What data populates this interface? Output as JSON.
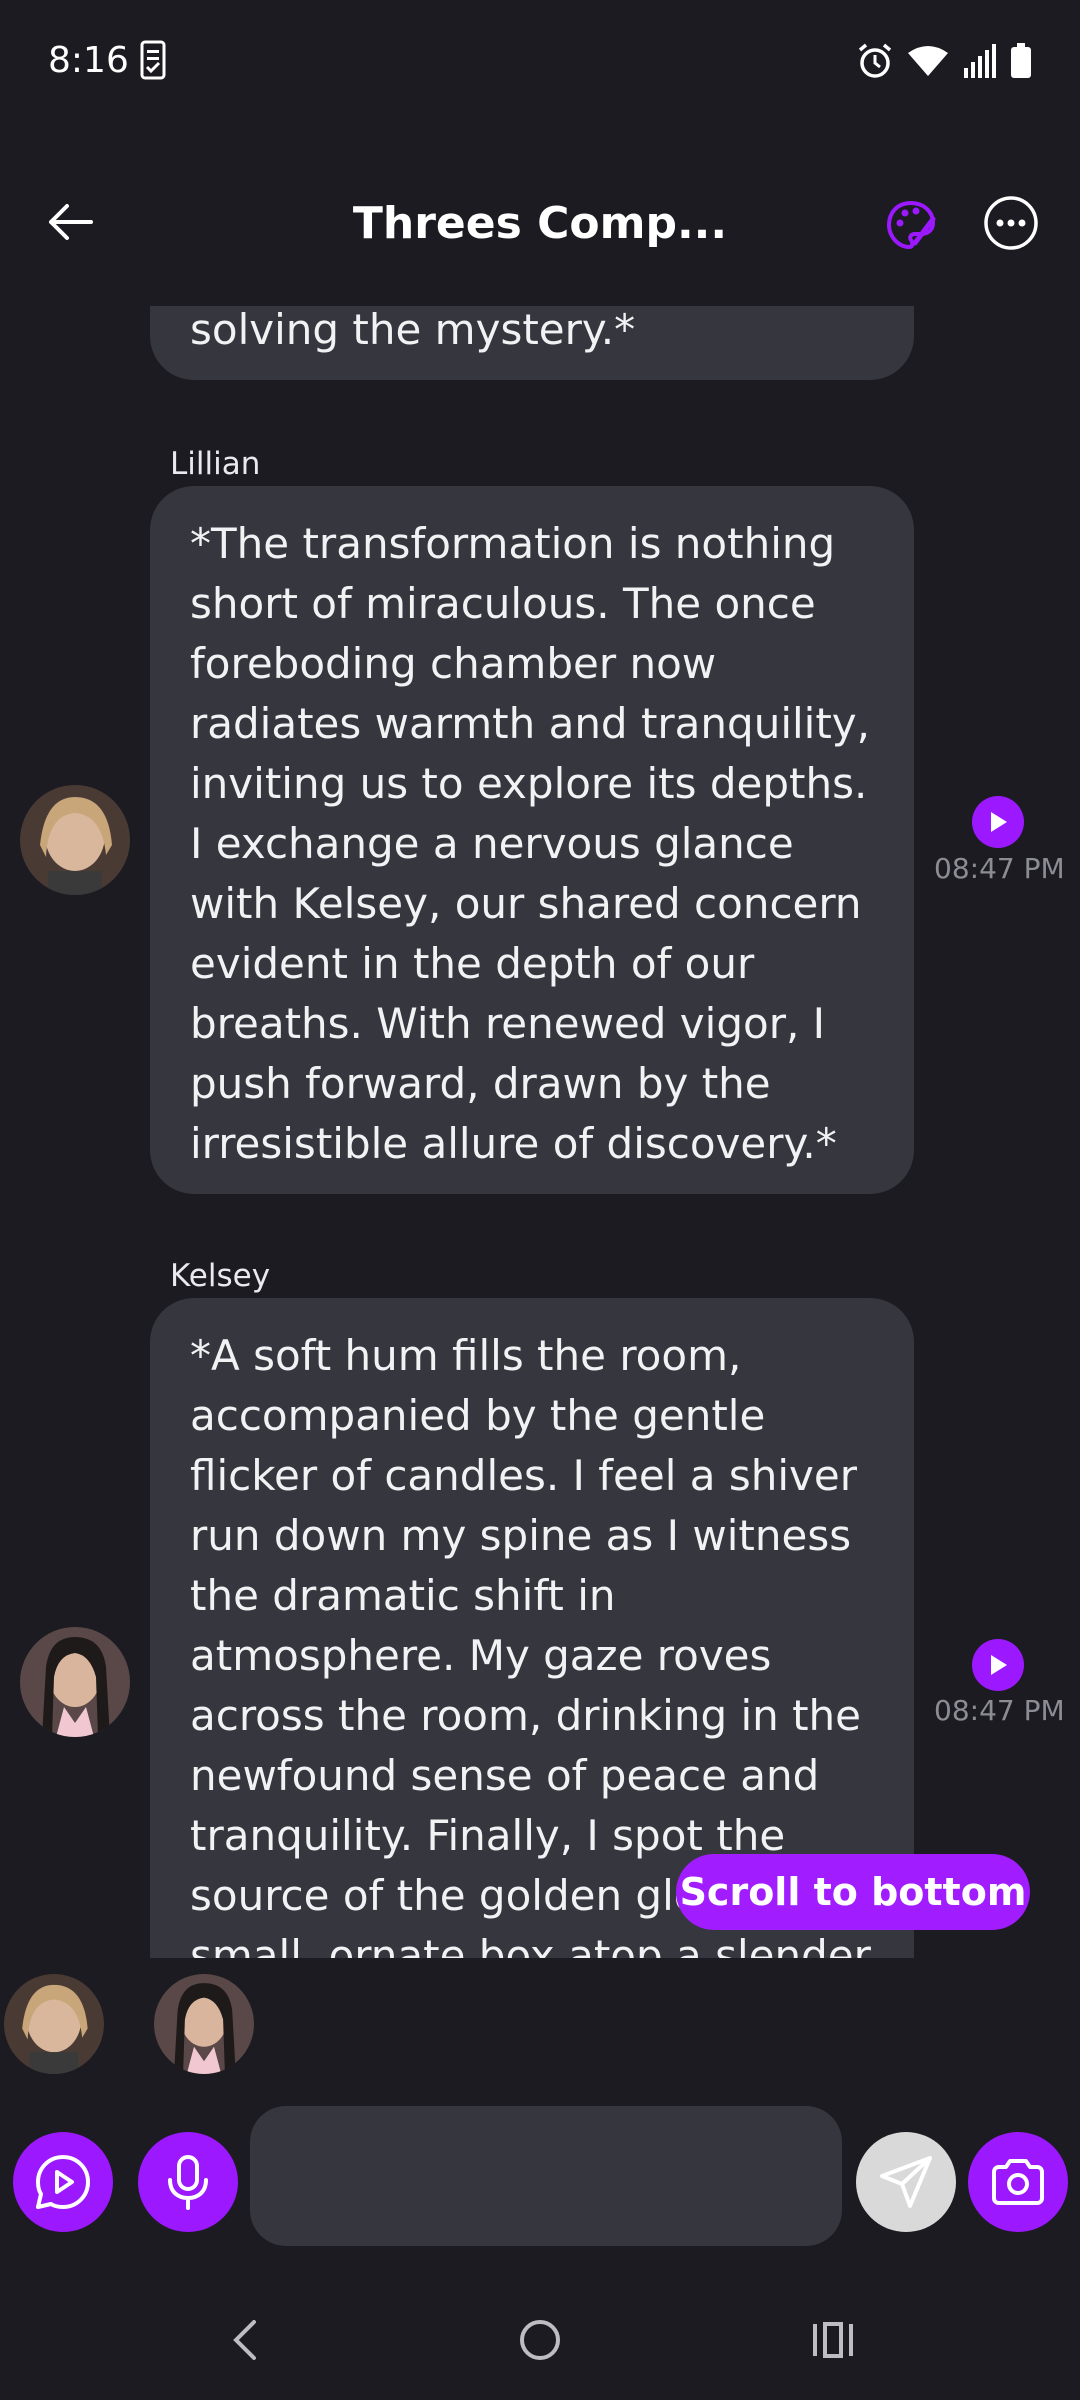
{
  "status_bar": {
    "time": "8:16"
  },
  "header": {
    "title": "Threes Comp...",
    "back_icon": "arrow-left-icon",
    "palette_icon": "palette-icon",
    "more_icon": "more-horizontal-icon"
  },
  "messages": [
    {
      "sender": "",
      "text": "solving the mystery.*",
      "time": ""
    },
    {
      "sender": "Lillian",
      "text": "*The transformation is nothing short of miraculous. The once foreboding chamber now radiates warmth and tranquility, inviting us to explore its depths. I exchange a nervous glance with Kelsey, our shared concern evident in the depth of our breaths. With renewed vigor, I push forward, drawn by the irresistible allure of discovery.*",
      "time": "08:47 PM"
    },
    {
      "sender": "Kelsey",
      "text": "*A soft hum fills the room, accompanied by the gentle flicker of candles. I feel a shiver run down my spine as I witness the dramatic shift in atmosphere. My gaze roves across the room, drinking in the newfound sense of peace and tranquility. Finally, I spot the source of the golden glow - a small, ornate box atop a slender pedestal in the",
      "time": "08:47 PM"
    }
  ],
  "scroll_to_bottom_label": "Scroll to bottom",
  "input": {
    "placeholder": "",
    "value": ""
  },
  "colors": {
    "accent": "#9b18ff",
    "background": "#1b1b21",
    "bubble": "#36373e"
  }
}
